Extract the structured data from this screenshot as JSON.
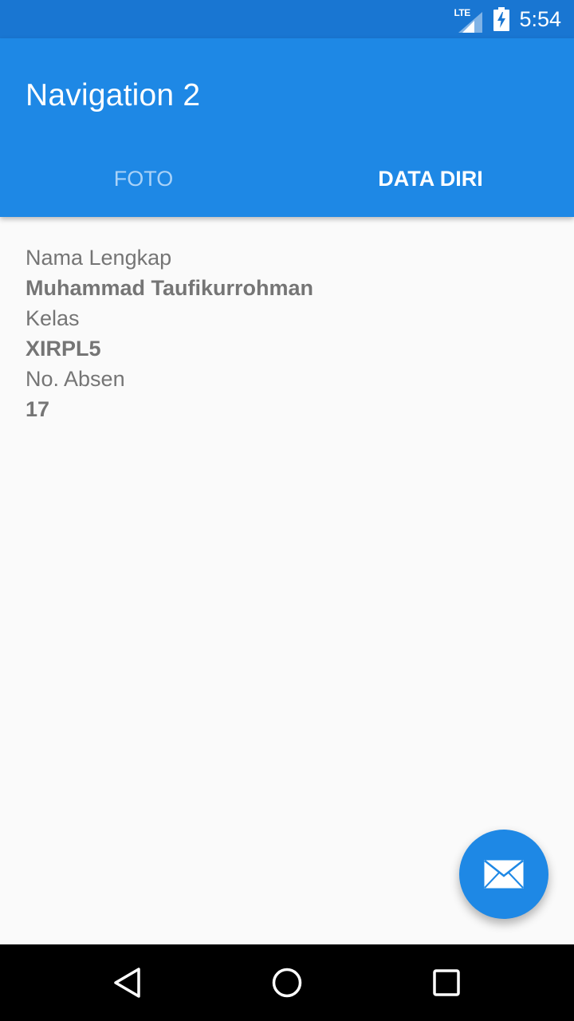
{
  "status_bar": {
    "network": "LTE",
    "time": "5:54",
    "icons": [
      "lte-signal-icon",
      "battery-charging-icon"
    ]
  },
  "app_bar": {
    "title": "Navigation 2",
    "color": "#1e88e5"
  },
  "tabs": [
    {
      "label": "FOTO",
      "selected": false
    },
    {
      "label": "DATA DIRI",
      "selected": true
    }
  ],
  "profile": {
    "name_label": "Nama Lengkap",
    "name_value": "Muhammad Taufikurrohman",
    "class_label": "Kelas",
    "class_value": "XIRPL5",
    "number_label": "No. Absen",
    "number_value": "17"
  },
  "fab": {
    "icon": "mail-icon",
    "color": "#1e88e5"
  },
  "nav_bar": {
    "icons": [
      "back-icon",
      "home-icon",
      "recents-icon"
    ]
  }
}
